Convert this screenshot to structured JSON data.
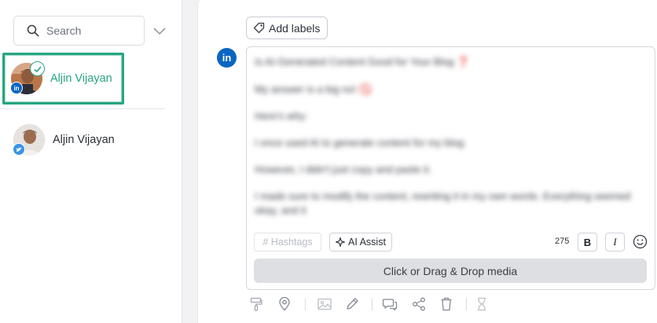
{
  "sidebar": {
    "search": {
      "placeholder": "Search"
    },
    "accounts": [
      {
        "name": "Aljin Vijayan",
        "network": "in",
        "network_label": "in",
        "selected": true
      },
      {
        "name": "Aljin Vijayan",
        "network": "twitter",
        "selected": false
      }
    ]
  },
  "composer": {
    "add_labels_label": "Add labels",
    "network_logo_text": "in",
    "post_lines": [
      "Is AI-Generated Content Good for Your Blog ❓",
      "My answer is a big no! 🚫",
      "Here's why:",
      "I once used AI to generate content for my blog.",
      "However, I didn't just copy and paste it.",
      " I made sure to modify the content, rewriting it in my own words. Everything seemed okay, and it"
    ],
    "hashtags_label": "# Hashtags",
    "ai_assist_label": "AI Assist",
    "char_count": "275",
    "bold_label": "B",
    "italic_label": "I",
    "media_drop_label": "Click or Drag & Drop media"
  },
  "colors": {
    "accent": "#27a582",
    "linkedin": "#0a66c2",
    "twitter": "#3b94e6",
    "media_bg": "#dedfe3"
  },
  "icons": {
    "search": "search-icon",
    "chevron": "chevron-down-icon",
    "tag": "tag-icon",
    "sparkle": "sparkle-icon",
    "emoji": "emoji-icon",
    "toolbar": [
      "paint-roller-icon",
      "location-pin-icon",
      "image-icon",
      "pencil-icon",
      "comment-icon",
      "share-icon",
      "trash-icon",
      "hourglass-icon"
    ]
  }
}
